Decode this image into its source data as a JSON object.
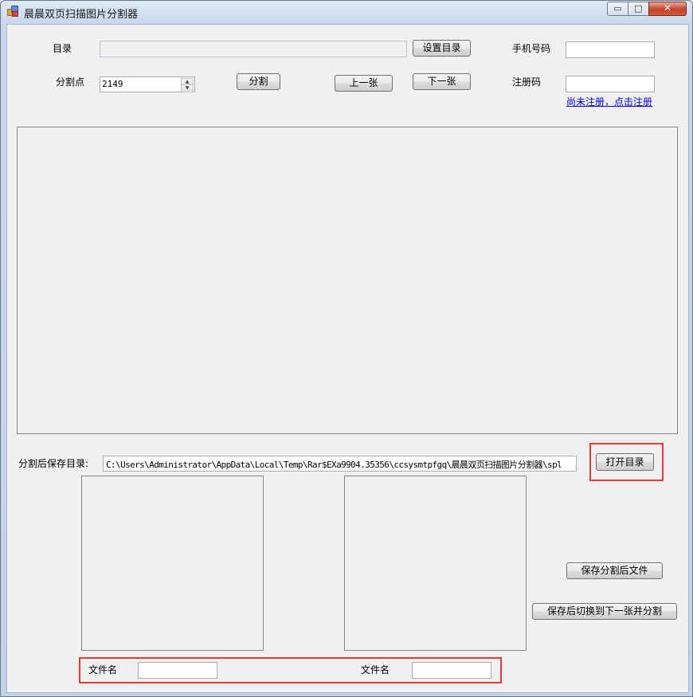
{
  "window": {
    "title": "晨晨双页扫描图片分割器",
    "min_glyph": "▭",
    "max_glyph": "□",
    "close_glyph": "✕"
  },
  "top": {
    "dir_label": "目录",
    "dir_value": "",
    "set_dir_button": "设置目录",
    "phone_label": "手机号码",
    "phone_value": "",
    "split_point_label": "分割点",
    "split_point_value": "2149",
    "spin_up": "▲",
    "spin_down": "▼",
    "split_button": "分割",
    "prev_button": "上一张",
    "next_button": "下一张",
    "reg_label": "注册码",
    "reg_value": "",
    "register_link": "尚未注册，点击注册"
  },
  "bottom": {
    "save_dir_label": "分割后保存目录:",
    "save_dir_value": "C:\\Users\\Administrator\\AppData\\Local\\Temp\\Rar$EXa9904.35356\\ccsysmtpfgq\\晨晨双页扫描图片分割器\\spl",
    "open_dir_button": "打开目录",
    "save_button": "保存分割后文件",
    "save_next_button": "保存后切换到下一张并分割",
    "filename_label_left": "文件名",
    "filename_value_left": "",
    "filename_label_right": "文件名",
    "filename_value_right": ""
  },
  "colors": {
    "highlight": "#e53935",
    "link": "#0000ee",
    "client_bg": "#f0f0f0"
  }
}
